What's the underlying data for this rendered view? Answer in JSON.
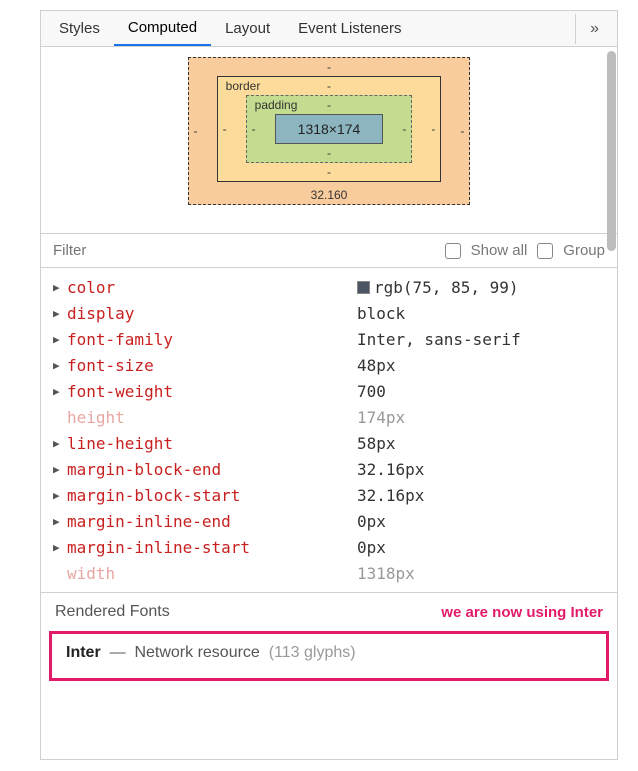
{
  "tabs": {
    "styles": "Styles",
    "computed": "Computed",
    "layout": "Layout",
    "events": "Event Listeners",
    "overflow": "»"
  },
  "boxmodel": {
    "border_label": "border",
    "padding_label": "padding",
    "content": "1318×174",
    "margin_bottom": "32.160",
    "dash": "-"
  },
  "filter": {
    "placeholder": "Filter",
    "showall": "Show all",
    "group": "Group"
  },
  "props": [
    {
      "name": "color",
      "value": "rgb(75, 85, 99)",
      "swatch": true,
      "tri": true
    },
    {
      "name": "display",
      "value": "block",
      "tri": true
    },
    {
      "name": "font-family",
      "value": "Inter, sans-serif",
      "tri": true
    },
    {
      "name": "font-size",
      "value": "48px",
      "tri": true
    },
    {
      "name": "font-weight",
      "value": "700",
      "tri": true
    },
    {
      "name": "height",
      "value": "174px",
      "dim": true
    },
    {
      "name": "line-height",
      "value": "58px",
      "tri": true
    },
    {
      "name": "margin-block-end",
      "value": "32.16px",
      "tri": true
    },
    {
      "name": "margin-block-start",
      "value": "32.16px",
      "tri": true
    },
    {
      "name": "margin-inline-end",
      "value": "0px",
      "tri": true
    },
    {
      "name": "margin-inline-start",
      "value": "0px",
      "tri": true
    },
    {
      "name": "width",
      "value": "1318px",
      "dim": true
    }
  ],
  "rendered": {
    "heading": "Rendered Fonts",
    "annotation": "we are now using Inter",
    "font_name": "Inter",
    "sep": "—",
    "source": "Network resource",
    "glyphs": "(113 glyphs)"
  }
}
